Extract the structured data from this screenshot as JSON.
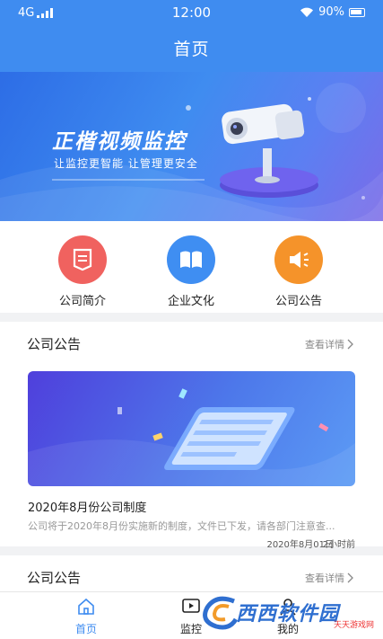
{
  "status": {
    "carrier": "4G",
    "time": "12:00",
    "battery": "90%"
  },
  "header": {
    "title": "首页"
  },
  "banner": {
    "title": "正楷视频监控",
    "subtitle": "让监控更智能 让管理更安全"
  },
  "quick_links": [
    {
      "label": "公司简介",
      "icon": "bookmark-icon",
      "color": "#f0625f"
    },
    {
      "label": "企业文化",
      "icon": "book-icon",
      "color": "#3f8ef2"
    },
    {
      "label": "公司公告",
      "icon": "speaker-icon",
      "color": "#f5932a"
    }
  ],
  "sections": [
    {
      "title": "公司公告",
      "more": "查看详情",
      "news": {
        "title": "2020年8月份公司制度",
        "desc": "公司将于2020年8月份实施新的制度，文件已下发，请各部门注意查...",
        "date": "2020年8月01日",
        "ago": "2小时前"
      }
    },
    {
      "title": "公司公告",
      "more": "查看详情"
    }
  ],
  "tabs": [
    {
      "label": "首页",
      "icon": "home-icon",
      "active": true
    },
    {
      "label": "监控",
      "icon": "video-play-icon",
      "active": false
    },
    {
      "label": "我的",
      "icon": "user-icon",
      "active": false
    }
  ],
  "watermark": {
    "text": "西西软件园",
    "tag": "天天游戏网"
  },
  "colors": {
    "primary": "#3f8cf0",
    "active_tab": "#3f8cf0"
  }
}
